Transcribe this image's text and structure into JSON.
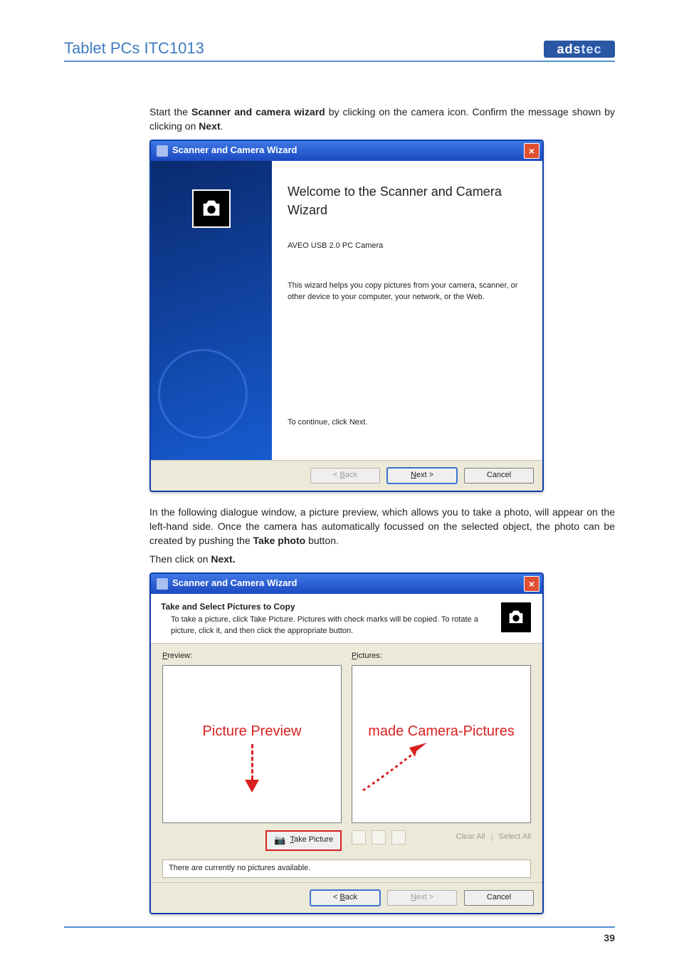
{
  "header": {
    "title": "Tablet PCs ITC1013",
    "logo": "adstec",
    "page_number": "39"
  },
  "text": {
    "intro_pre": "Start the ",
    "intro_bold1": "Scanner and camera wizard",
    "intro_mid": " by clicking on the camera icon. Confirm the message shown by clicking on ",
    "intro_bold2": "Next",
    "intro_end": ".",
    "para2_pre": "In the following dialogue window, a picture preview, which allows you to take a photo, will appear on the left-hand side. Once the camera has automatically focussed on the selected object, the photo can be created by pushing the ",
    "para2_bold": "Take photo",
    "para2_end": " button.",
    "para3_pre": "Then click on ",
    "para3_bold": "Next.",
    "overlay_left": "Picture Preview",
    "overlay_right": "made Camera-Pictures"
  },
  "dialog1": {
    "title": "Scanner and Camera Wizard",
    "welcome": "Welcome to the Scanner and Camera Wizard",
    "device": "AVEO USB 2.0 PC Camera",
    "description": "This wizard helps you copy pictures from your camera, scanner, or other device to your computer, your network, or the Web.",
    "continue_text": "To continue, click Next.",
    "back": "< Back",
    "next": "Next >",
    "cancel": "Cancel"
  },
  "dialog2": {
    "title": "Scanner and Camera Wizard",
    "header_title": "Take and Select Pictures to Copy",
    "header_sub": "To take a picture, click Take Picture. Pictures with check marks will be copied. To rotate a picture, click it, and then click the appropriate button.",
    "preview_label": "Preview:",
    "pictures_label": "Pictures:",
    "take_picture": "Take Picture",
    "clear_all": "Clear All",
    "select_all": "Select All",
    "status": "There are currently no pictures available.",
    "back": "< Back",
    "next": "Next >",
    "cancel": "Cancel"
  }
}
